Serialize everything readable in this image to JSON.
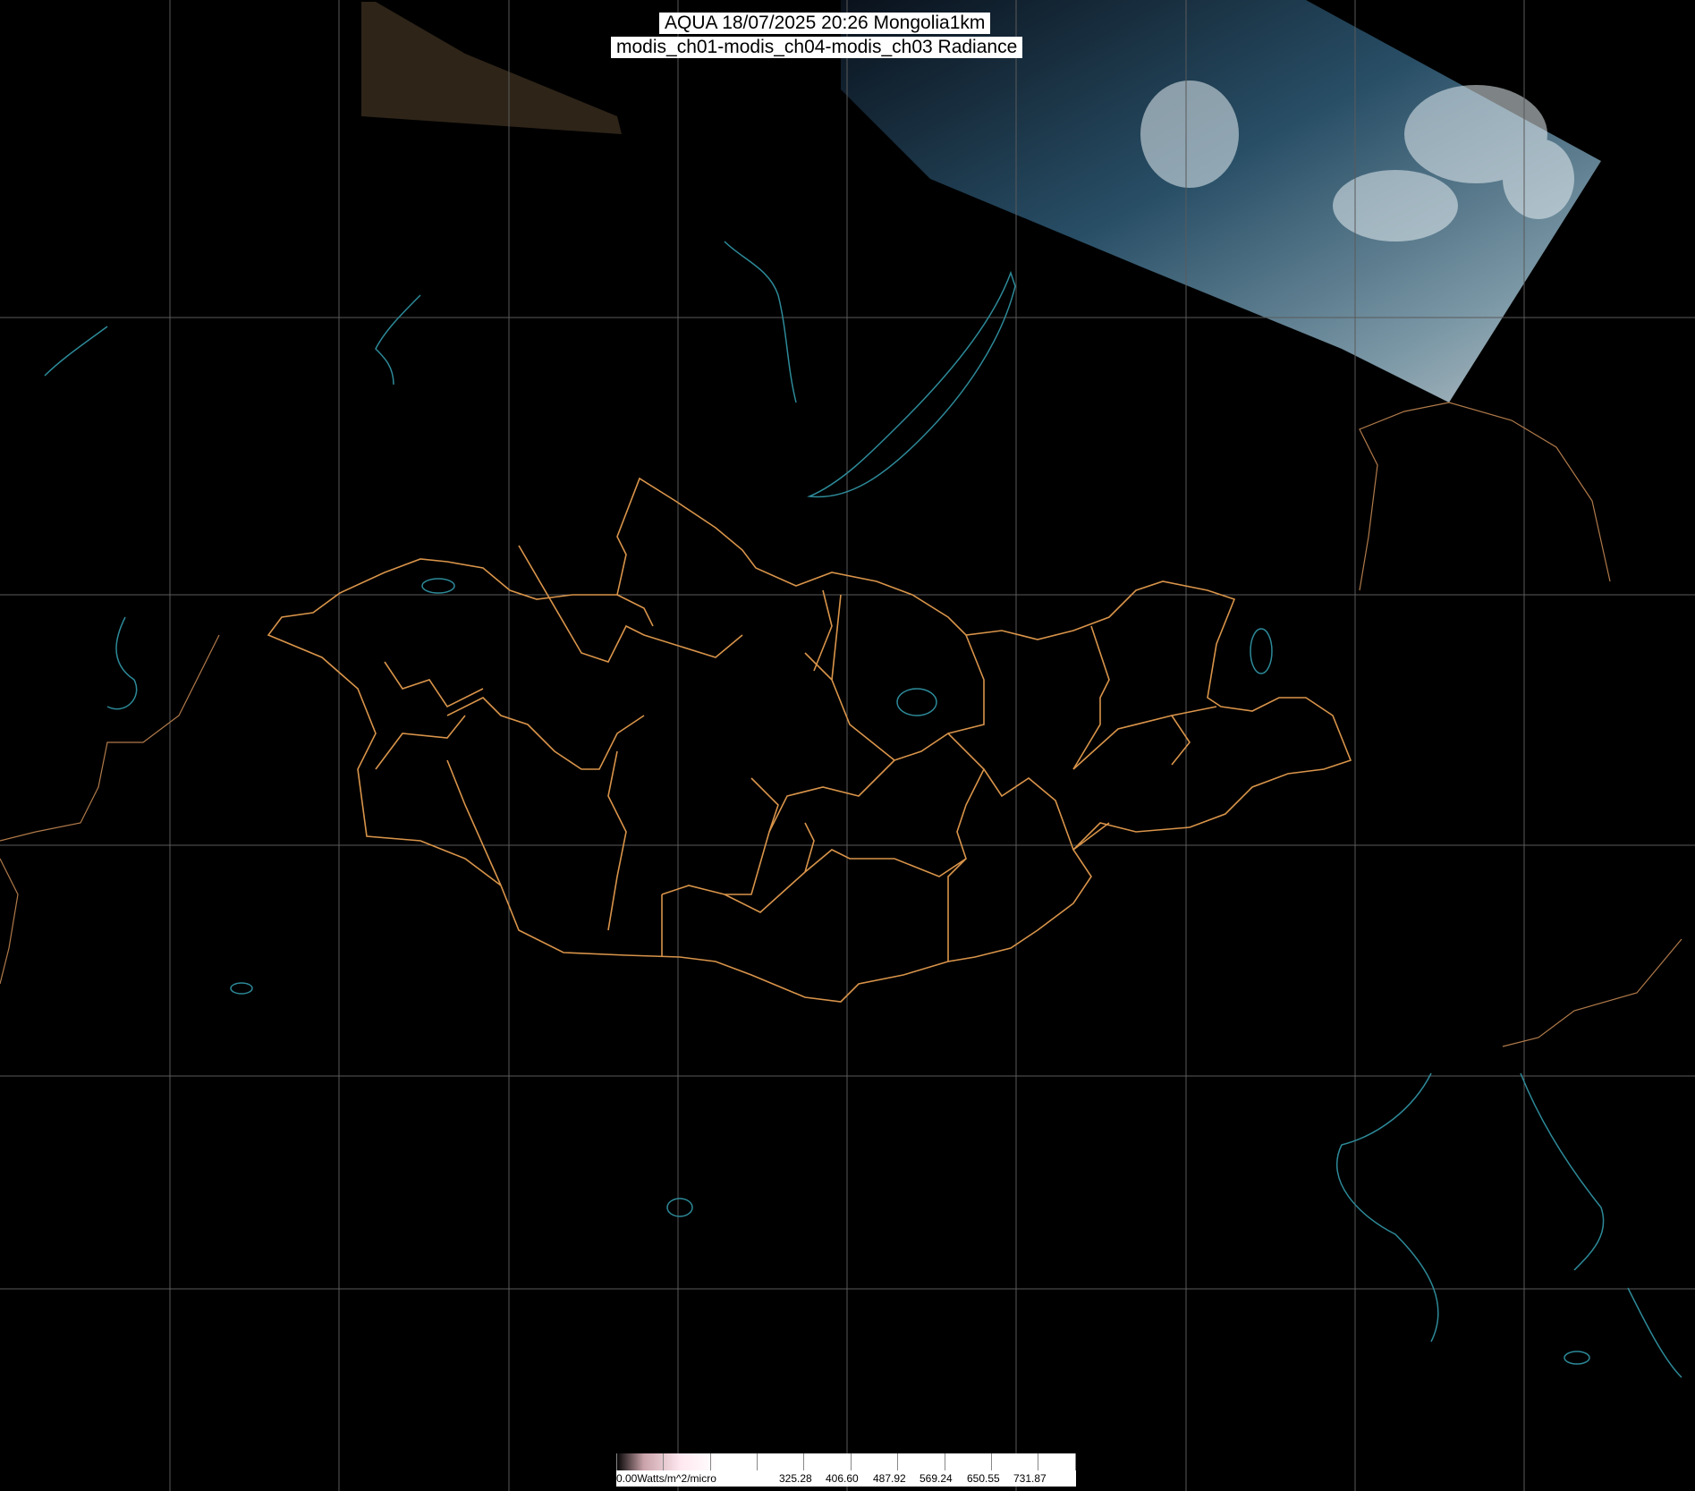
{
  "title": {
    "line1": "AQUA 18/07/2025 20:26 Mongolia1km",
    "line2": "modis_ch01-modis_ch04-modis_ch03 Radiance"
  },
  "colorbar": {
    "unit_label": "0.00Watts/m^2/micro",
    "tick_labels": [
      "325.28",
      "406.60",
      "487.92",
      "569.24",
      "650.55",
      "731.87"
    ]
  },
  "colors": {
    "background": "#000000",
    "graticule": "#5a5a5a",
    "admin_border": "#d9944a",
    "coastline": "#2d8a99",
    "country_border": "#b07a4a"
  }
}
